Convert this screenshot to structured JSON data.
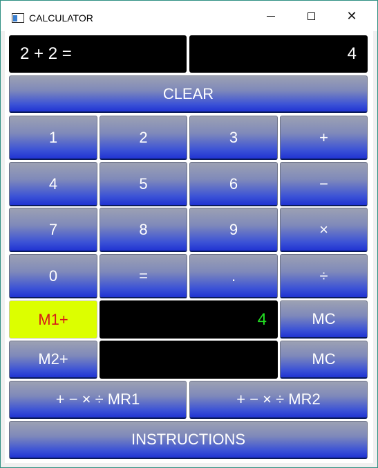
{
  "window": {
    "title": "CALCULATOR",
    "controls": {
      "minimize": "minimize",
      "maximize": "maximize",
      "close": "✕"
    }
  },
  "display": {
    "expression": "2 + 2 =",
    "result": "4"
  },
  "buttons": {
    "clear": "CLEAR",
    "one": "1",
    "two": "2",
    "three": "3",
    "plus": "+",
    "four": "4",
    "five": "5",
    "six": "6",
    "minus": "−",
    "seven": "7",
    "eight": "8",
    "nine": "9",
    "times": "×",
    "zero": "0",
    "equals": "=",
    "dot": ".",
    "divide": "÷",
    "m1_plus": "M1+",
    "m2_plus": "M2+",
    "mc1": "MC",
    "mc2": "MC",
    "mr1": "+ − × ÷ MR1",
    "mr2": "+ − × ÷ MR2",
    "instructions": "INSTRUCTIONS"
  },
  "memory": {
    "m1_value": "4",
    "m2_value": ""
  },
  "colors": {
    "button_gradient_top": "#9ca1b3",
    "button_gradient_bottom": "#2033d2",
    "m1_button_bg": "#dcff00",
    "m1_button_text": "#d81818",
    "memory_value_text": "#22dd22",
    "display_bg": "#000000"
  }
}
